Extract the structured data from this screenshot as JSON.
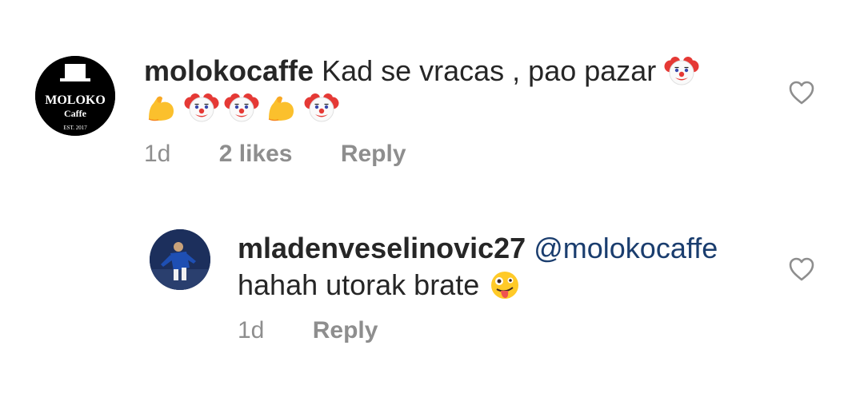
{
  "comments": [
    {
      "username": "molokocaffe",
      "text": "Kad se vracas , pao pazar",
      "emojis_line1": [
        "clown-face-emoji"
      ],
      "emojis_line2": [
        "flexed-biceps-emoji",
        "clown-face-emoji",
        "clown-face-emoji",
        "flexed-biceps-emoji",
        "clown-face-emoji"
      ],
      "time": "1d",
      "likes": "2 likes",
      "reply_label": "Reply",
      "avatar": {
        "line1": "MOLO",
        "line2": "KO",
        "line3": "Caffe",
        "line4": "EST. 2017"
      }
    },
    {
      "username": "mladenveselinovic27",
      "mention": "@molokocaffe",
      "text": "hahah utorak brate",
      "emojis": [
        "zany-face-emoji"
      ],
      "time": "1d",
      "reply_label": "Reply"
    }
  ],
  "colors": {
    "text": "#262626",
    "muted": "#8e8e8e",
    "mention": "#1a3d6e",
    "background": "#ffffff"
  }
}
